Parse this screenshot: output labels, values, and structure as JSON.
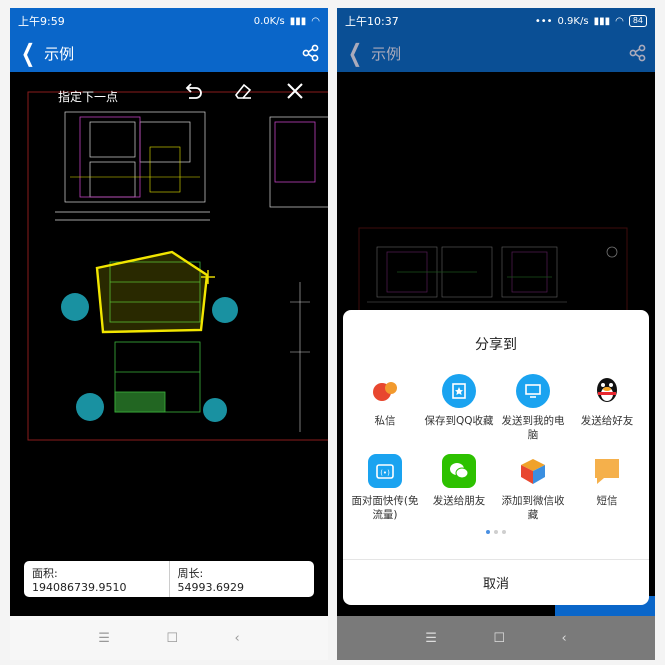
{
  "left": {
    "status": {
      "time": "上午9:59",
      "speed": "0.0K/s"
    },
    "title": "示例",
    "toolbar": {
      "prompt": "指定下一点"
    },
    "measure": {
      "area_label": "面积:",
      "area_value": "194086739.9510",
      "perimeter_label": "周长:",
      "perimeter_value": "54993.6929"
    },
    "icons": [
      "back-arrow-icon",
      "share-icon",
      "undo-icon",
      "eraser-icon",
      "close-icon"
    ]
  },
  "right": {
    "status": {
      "time": "上午10:37",
      "speed": "0.9K/s",
      "battery": "84"
    },
    "title": "示例",
    "share_sheet": {
      "title": "分享到",
      "items": [
        {
          "label": "私信",
          "icon": "private-message-icon",
          "color": "#e8472f"
        },
        {
          "label": "保存到QQ收藏",
          "icon": "qq-favorite-icon",
          "color": "#1aa3f0"
        },
        {
          "label": "发送到我的电脑",
          "icon": "my-computer-icon",
          "color": "#1aa3f0"
        },
        {
          "label": "发送给好友",
          "icon": "qq-penguin-icon",
          "color": "#111111"
        },
        {
          "label": "面对面快传(免流量)",
          "icon": "face-transfer-icon",
          "color": "#1aa3f0"
        },
        {
          "label": "发送给朋友",
          "icon": "wechat-icon",
          "color": "#2dc100"
        },
        {
          "label": "添加到微信收藏",
          "icon": "wechat-favorite-icon",
          "color": "#f0a22a"
        },
        {
          "label": "短信",
          "icon": "sms-icon",
          "color": "#f5b04b"
        }
      ],
      "cancel_label": "取消"
    }
  },
  "nav": {
    "menu": "☰",
    "home": "☐",
    "back": "‹"
  }
}
